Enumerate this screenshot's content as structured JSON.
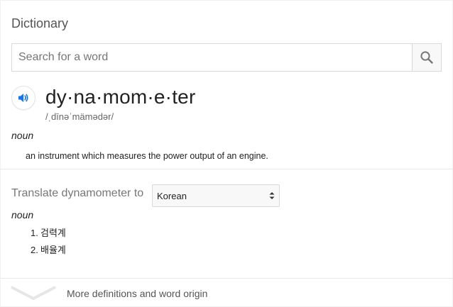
{
  "section_title": "Dictionary",
  "search": {
    "placeholder": "Search for a word",
    "value": ""
  },
  "entry": {
    "headword": "dy·na·mom·e·ter",
    "phonetic": "/ˌdīnəˈmämədər/",
    "part_of_speech": "noun",
    "definition": "an instrument which measures the power output of an engine."
  },
  "translate": {
    "label": "Translate dynamometer to",
    "selected_language": "Korean",
    "part_of_speech": "noun",
    "results": [
      {
        "num": "1.",
        "text": "검력계"
      },
      {
        "num": "2.",
        "text": "배율계"
      }
    ]
  },
  "footer": {
    "more_label": "More definitions and word origin"
  },
  "colors": {
    "accent_blue": "#1a73e8",
    "muted_text": "#777777",
    "border": "#d9d9d9"
  },
  "icons": {
    "search": "search-icon",
    "audio": "speaker-icon",
    "expand": "chevron-down-icon",
    "select": "select-arrows-icon"
  }
}
